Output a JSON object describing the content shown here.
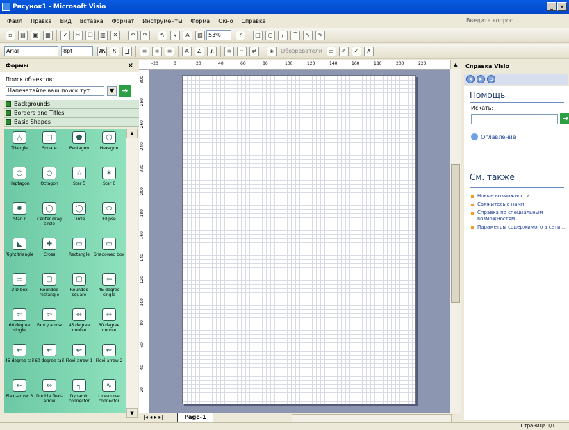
{
  "window": {
    "title": "Рисунок1 - Microsoft Visio",
    "buttons": [
      "_",
      "×"
    ]
  },
  "menu": {
    "items": [
      "Файл",
      "Правка",
      "Вид",
      "Вставка",
      "Формат",
      "Инструменты",
      "Форма",
      "Окно",
      "Справка"
    ],
    "help_placeholder": "Введите вопрос"
  },
  "toolbar": {
    "zoom": "53%",
    "font": "Arial",
    "size": "8pt",
    "bold": "Ж",
    "italic": "К",
    "underline": "Ч",
    "reviewer": "Обозреватели"
  },
  "shapes": {
    "title": "Формы",
    "search_label": "Поиск объектов:",
    "search_placeholder": "Напечатайте ваш поиск тут",
    "stencils": [
      "Backgrounds",
      "Borders and Titles",
      "Basic Shapes"
    ],
    "items": [
      {
        "label": "Triangle",
        "glyph": "△"
      },
      {
        "label": "Square",
        "glyph": "□"
      },
      {
        "label": "Pentagon",
        "glyph": "⬟"
      },
      {
        "label": "Hexagon",
        "glyph": "⬡"
      },
      {
        "label": "Heptagon",
        "glyph": "○"
      },
      {
        "label": "Octagon",
        "glyph": "○"
      },
      {
        "label": "Star 5",
        "glyph": "☆"
      },
      {
        "label": "Star 6",
        "glyph": "✶"
      },
      {
        "label": "Star 7",
        "glyph": "✹"
      },
      {
        "label": "Center drag circle",
        "glyph": "◯"
      },
      {
        "label": "Circle",
        "glyph": "◯"
      },
      {
        "label": "Ellipse",
        "glyph": "⬭"
      },
      {
        "label": "Right triangle",
        "glyph": "◣"
      },
      {
        "label": "Cross",
        "glyph": "✚"
      },
      {
        "label": "Rectangle",
        "glyph": "▭"
      },
      {
        "label": "Shadowed box",
        "glyph": "▭"
      },
      {
        "label": "3-D box",
        "glyph": "▭"
      },
      {
        "label": "Rounded rectangle",
        "glyph": "▢"
      },
      {
        "label": "Rounded square",
        "glyph": "▢"
      },
      {
        "label": "45 degree single",
        "glyph": "⇦"
      },
      {
        "label": "60 degree single",
        "glyph": "⇦"
      },
      {
        "label": "Fancy arrow",
        "glyph": "⇦"
      },
      {
        "label": "45 degree double",
        "glyph": "⇔"
      },
      {
        "label": "60 degree double",
        "glyph": "⇔"
      },
      {
        "label": "45 degree tail",
        "glyph": "⇤"
      },
      {
        "label": "60 degree tail",
        "glyph": "⇤"
      },
      {
        "label": "Flexi-arrow 1",
        "glyph": "⇜"
      },
      {
        "label": "Flexi-arrow 2",
        "glyph": "⇜"
      },
      {
        "label": "Flexi-arrow 3",
        "glyph": "⇜"
      },
      {
        "label": "Double flexi-arrow",
        "glyph": "↭"
      },
      {
        "label": "Dynamic connector",
        "glyph": "┐"
      },
      {
        "label": "Line-curve connector",
        "glyph": "∿"
      }
    ]
  },
  "ruler": {
    "top": [
      "-20",
      "0",
      "20",
      "40",
      "60",
      "80",
      "100",
      "120",
      "140",
      "160",
      "180",
      "200",
      "220"
    ],
    "left": [
      "300",
      "280",
      "260",
      "240",
      "220",
      "200",
      "180",
      "160",
      "140",
      "120",
      "100",
      "80",
      "60",
      "40",
      "20"
    ]
  },
  "page_tab": "Page-1",
  "status": "Страница 1/1",
  "help": {
    "title": "Справка Visio",
    "heading": "Помощь",
    "search_label": "Искать:",
    "toc": "Оглавление",
    "see_also": "См. также",
    "links": [
      "Новые возможности",
      "Свяжитесь с нами",
      "Справка по специальным возможностям",
      "Параметры содержимого в сети..."
    ]
  }
}
